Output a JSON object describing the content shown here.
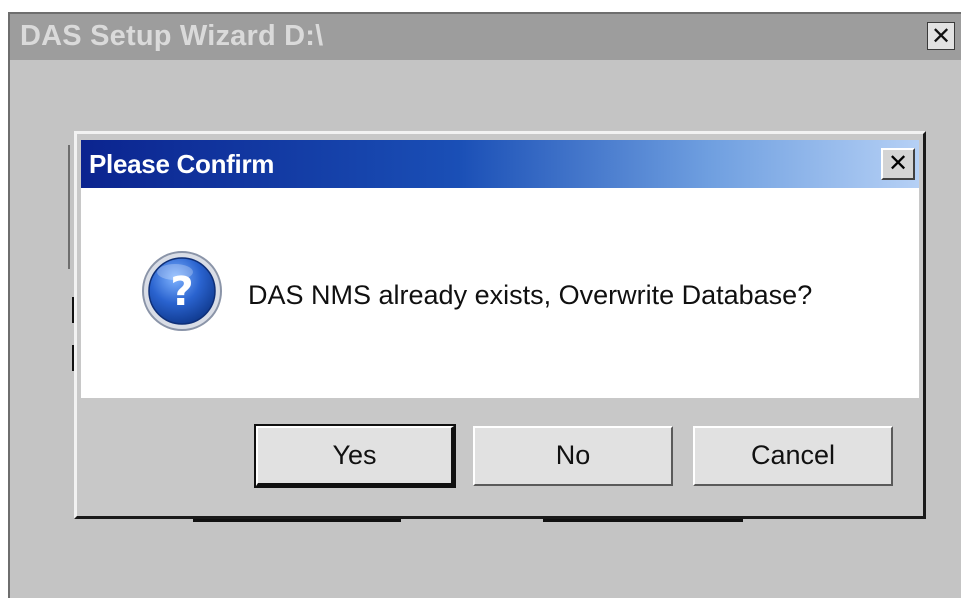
{
  "wizard": {
    "title": "DAS Setup Wizard D:\\",
    "close_label": "✕"
  },
  "dialog": {
    "title": "Please Confirm",
    "close_label": "✕",
    "icon": "question-icon",
    "message": "DAS NMS already exists, Overwrite Database?",
    "buttons": {
      "yes": "Yes",
      "no": "No",
      "cancel": "Cancel"
    }
  },
  "colors": {
    "title_gradient_start": "#0b248f",
    "title_gradient_end": "#b5d0f5",
    "icon_blue": "#1e5bc6"
  }
}
